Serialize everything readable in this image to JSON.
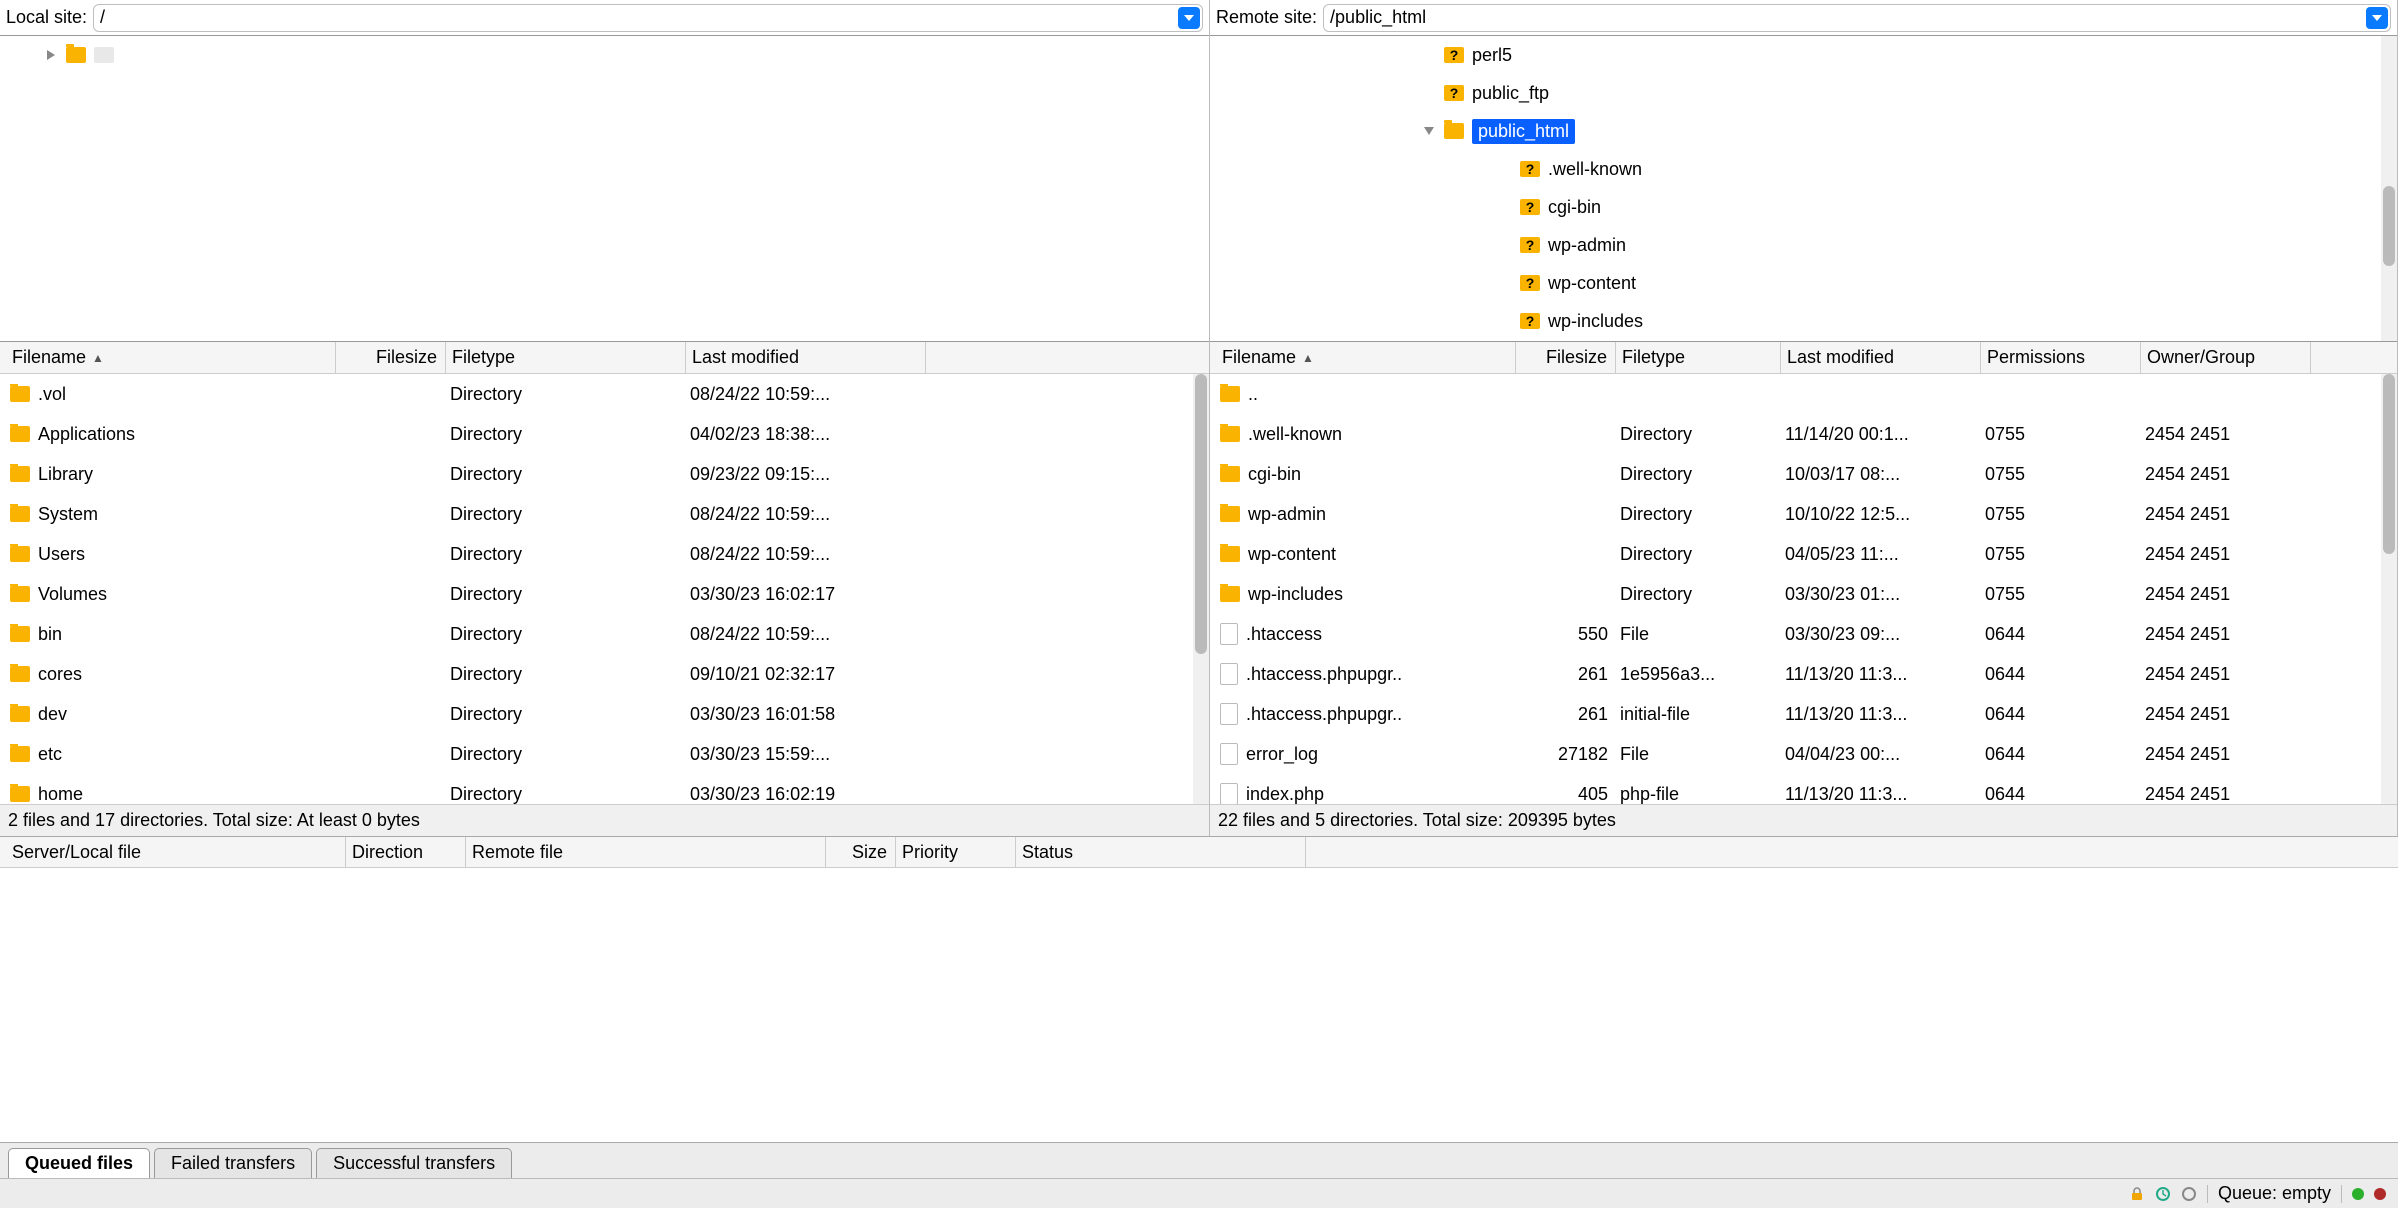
{
  "local": {
    "label": "Local site:",
    "path": "/",
    "tree": {
      "root": "/"
    },
    "columns": {
      "filename": "Filename",
      "filesize": "Filesize",
      "filetype": "Filetype",
      "modified": "Last modified"
    },
    "files": [
      {
        "n": ".vol",
        "t": "Directory",
        "m": "08/24/22 10:59:..."
      },
      {
        "n": "Applications",
        "t": "Directory",
        "m": "04/02/23 18:38:..."
      },
      {
        "n": "Library",
        "t": "Directory",
        "m": "09/23/22 09:15:..."
      },
      {
        "n": "System",
        "t": "Directory",
        "m": "08/24/22 10:59:..."
      },
      {
        "n": "Users",
        "t": "Directory",
        "m": "08/24/22 10:59:..."
      },
      {
        "n": "Volumes",
        "t": "Directory",
        "m": "03/30/23 16:02:17"
      },
      {
        "n": "bin",
        "t": "Directory",
        "m": "08/24/22 10:59:..."
      },
      {
        "n": "cores",
        "t": "Directory",
        "m": "09/10/21 02:32:17"
      },
      {
        "n": "dev",
        "t": "Directory",
        "m": "03/30/23 16:01:58"
      },
      {
        "n": "etc",
        "t": "Directory",
        "m": "03/30/23 15:59:..."
      },
      {
        "n": "home",
        "t": "Directory",
        "m": "03/30/23 16:02:19"
      }
    ],
    "status": "2 files and 17 directories. Total size: At least 0 bytes"
  },
  "remote": {
    "label": "Remote site:",
    "path": "/public_html",
    "tree": [
      {
        "n": "perl5",
        "d": 2,
        "q": true
      },
      {
        "n": "public_ftp",
        "d": 2,
        "q": true
      },
      {
        "n": "public_html",
        "d": 2,
        "q": false,
        "open": true,
        "sel": true
      },
      {
        "n": ".well-known",
        "d": 3,
        "q": true
      },
      {
        "n": "cgi-bin",
        "d": 3,
        "q": true
      },
      {
        "n": "wp-admin",
        "d": 3,
        "q": true
      },
      {
        "n": "wp-content",
        "d": 3,
        "q": true
      },
      {
        "n": "wp-includes",
        "d": 3,
        "q": true
      }
    ],
    "columns": {
      "filename": "Filename",
      "filesize": "Filesize",
      "filetype": "Filetype",
      "modified": "Last modified",
      "perm": "Permissions",
      "owner": "Owner/Group"
    },
    "files": [
      {
        "n": "..",
        "parent": true
      },
      {
        "n": ".well-known",
        "dir": true,
        "t": "Directory",
        "m": "11/14/20 00:1...",
        "p": "0755",
        "o": "2454 2451"
      },
      {
        "n": "cgi-bin",
        "dir": true,
        "t": "Directory",
        "m": "10/03/17 08:...",
        "p": "0755",
        "o": "2454 2451"
      },
      {
        "n": "wp-admin",
        "dir": true,
        "t": "Directory",
        "m": "10/10/22 12:5...",
        "p": "0755",
        "o": "2454 2451"
      },
      {
        "n": "wp-content",
        "dir": true,
        "t": "Directory",
        "m": "04/05/23 11:...",
        "p": "0755",
        "o": "2454 2451"
      },
      {
        "n": "wp-includes",
        "dir": true,
        "t": "Directory",
        "m": "03/30/23 01:...",
        "p": "0755",
        "o": "2454 2451"
      },
      {
        "n": ".htaccess",
        "s": "550",
        "t": "File",
        "m": "03/30/23 09:...",
        "p": "0644",
        "o": "2454 2451"
      },
      {
        "n": ".htaccess.phpupgr..",
        "s": "261",
        "t": "1e5956a3...",
        "m": "11/13/20 11:3...",
        "p": "0644",
        "o": "2454 2451"
      },
      {
        "n": ".htaccess.phpupgr..",
        "s": "261",
        "t": "initial-file",
        "m": "11/13/20 11:3...",
        "p": "0644",
        "o": "2454 2451"
      },
      {
        "n": "error_log",
        "s": "27182",
        "t": "File",
        "m": "04/04/23 00:...",
        "p": "0644",
        "o": "2454 2451"
      },
      {
        "n": "index.php",
        "s": "405",
        "t": "php-file",
        "m": "11/13/20 11:3...",
        "p": "0644",
        "o": "2454 2451"
      }
    ],
    "status": "22 files and 5 directories. Total size: 209395 bytes"
  },
  "queue": {
    "columns": {
      "server": "Server/Local file",
      "direction": "Direction",
      "remote": "Remote file",
      "size": "Size",
      "priority": "Priority",
      "status": "Status"
    }
  },
  "tabs": {
    "queued": "Queued files",
    "failed": "Failed transfers",
    "success": "Successful transfers"
  },
  "footer": {
    "queue": "Queue: empty"
  }
}
